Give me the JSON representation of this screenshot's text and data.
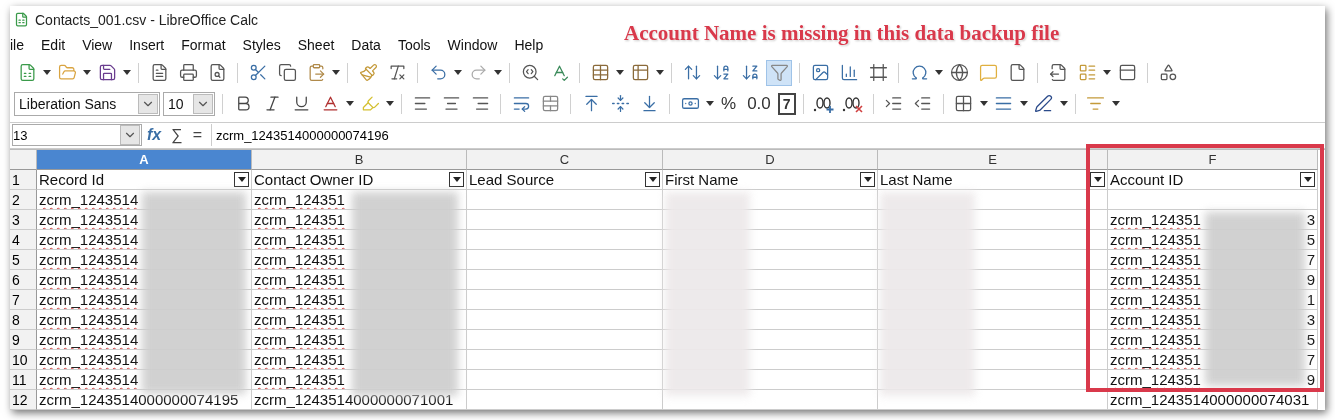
{
  "window": {
    "title": "Contacts_001.csv - LibreOffice Calc"
  },
  "annotation": {
    "text": "Account Name is missing in this data backup file"
  },
  "header_row_number": "1",
  "menu": [
    "ile",
    "Edit",
    "View",
    "Insert",
    "Format",
    "Styles",
    "Sheet",
    "Data",
    "Tools",
    "Window",
    "Help"
  ],
  "toolbar": {
    "autofilter_active": true
  },
  "format_bar": {
    "font": "Liberation Sans",
    "size": "10",
    "number_labels": [
      "%",
      "0.0",
      "7"
    ]
  },
  "formula_bar": {
    "cell": "13",
    "symbols": [
      "fx",
      "∑",
      "="
    ],
    "content": "zcrm_1243514000000074196"
  },
  "columns": [
    {
      "letter": "A",
      "selected": true,
      "header": "Record Id"
    },
    {
      "letter": "B",
      "selected": false,
      "header": "Contact Owner ID"
    },
    {
      "letter": "C",
      "selected": false,
      "header": "Lead Source"
    },
    {
      "letter": "D",
      "selected": false,
      "header": "First Name"
    },
    {
      "letter": "E",
      "selected": false,
      "header": "Last Name"
    },
    {
      "letter": "F",
      "selected": false,
      "header": "Account ID"
    }
  ],
  "rows": [
    {
      "number": "2",
      "cells": [
        "zcrm_1243514",
        "zcrm_124351",
        "",
        "",
        "",
        ""
      ],
      "tail": ""
    },
    {
      "number": "3",
      "cells": [
        "zcrm_1243514",
        "zcrm_124351",
        "",
        "",
        "",
        "zcrm_124351"
      ],
      "tail": "3"
    },
    {
      "number": "4",
      "cells": [
        "zcrm_1243514",
        "zcrm_124351",
        "",
        "",
        "",
        "zcrm_124351"
      ],
      "tail": "5"
    },
    {
      "number": "5",
      "cells": [
        "zcrm_1243514",
        "zcrm_124351",
        "",
        "",
        "",
        "zcrm_124351"
      ],
      "tail": "7"
    },
    {
      "number": "6",
      "cells": [
        "zcrm_1243514",
        "zcrm_124351",
        "",
        "",
        "",
        "zcrm_124351"
      ],
      "tail": "9"
    },
    {
      "number": "7",
      "cells": [
        "zcrm_1243514",
        "zcrm_124351",
        "",
        "",
        "",
        "zcrm_124351"
      ],
      "tail": "1"
    },
    {
      "number": "8",
      "cells": [
        "zcrm_1243514",
        "zcrm_124351",
        "",
        "",
        "",
        "zcrm_124351"
      ],
      "tail": "3"
    },
    {
      "number": "9",
      "cells": [
        "zcrm_1243514",
        "zcrm_124351",
        "",
        "",
        "",
        "zcrm_124351"
      ],
      "tail": "5"
    },
    {
      "number": "10",
      "cells": [
        "zcrm_1243514",
        "zcrm_124351",
        "",
        "",
        "",
        "zcrm_124351"
      ],
      "tail": "7"
    },
    {
      "number": "11",
      "cells": [
        "zcrm_1243514",
        "zcrm_124351",
        "",
        "",
        "",
        "zcrm_124351"
      ],
      "tail": "9"
    },
    {
      "number": "12",
      "cells": [
        "zcrm_1243514000000074195",
        "zcrm_1243514000000071001",
        "",
        "",
        "",
        "zcrm_1243514000000074031"
      ],
      "tail": ""
    }
  ]
}
